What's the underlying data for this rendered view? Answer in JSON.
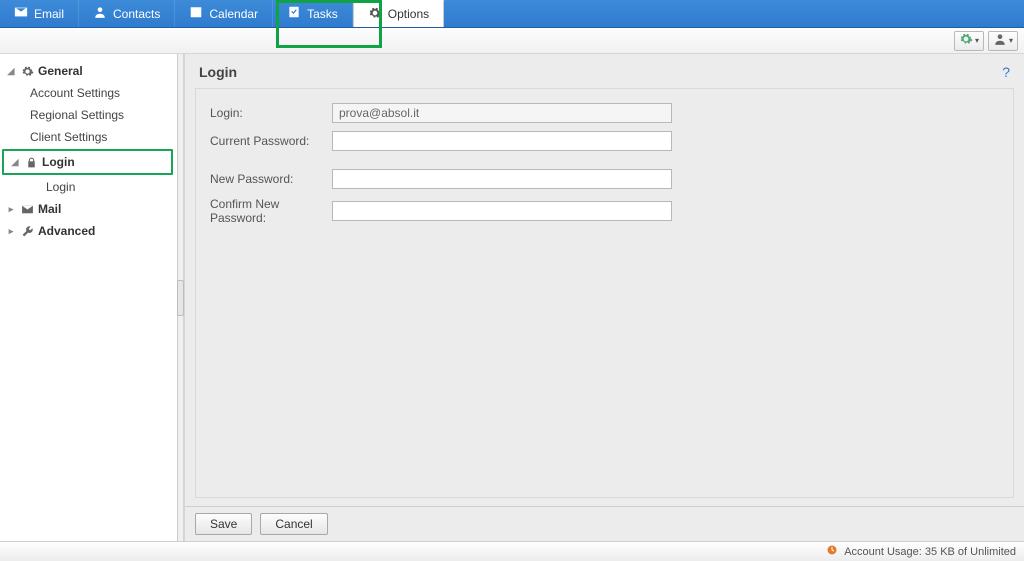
{
  "topnav": {
    "tabs": [
      {
        "label": "Email"
      },
      {
        "label": "Contacts"
      },
      {
        "label": "Calendar"
      },
      {
        "label": "Tasks"
      },
      {
        "label": "Options"
      }
    ]
  },
  "sidebar": {
    "general": {
      "label": "General",
      "children": {
        "account_settings": "Account Settings",
        "regional_settings": "Regional Settings",
        "client_settings": "Client Settings"
      }
    },
    "login_section": {
      "label": "Login",
      "children": {
        "login": "Login"
      }
    },
    "mail": {
      "label": "Mail"
    },
    "advanced": {
      "label": "Advanced"
    }
  },
  "main": {
    "title": "Login",
    "help": "?",
    "form": {
      "login_label": "Login:",
      "login_value": "prova@absol.it",
      "current_password_label": "Current Password:",
      "current_password_value": "",
      "new_password_label": "New Password:",
      "new_password_value": "",
      "confirm_password_label": "Confirm New Password:",
      "confirm_password_value": ""
    },
    "buttons": {
      "save": "Save",
      "cancel": "Cancel"
    }
  },
  "status": {
    "usage": "Account Usage: 35 KB of Unlimited"
  }
}
